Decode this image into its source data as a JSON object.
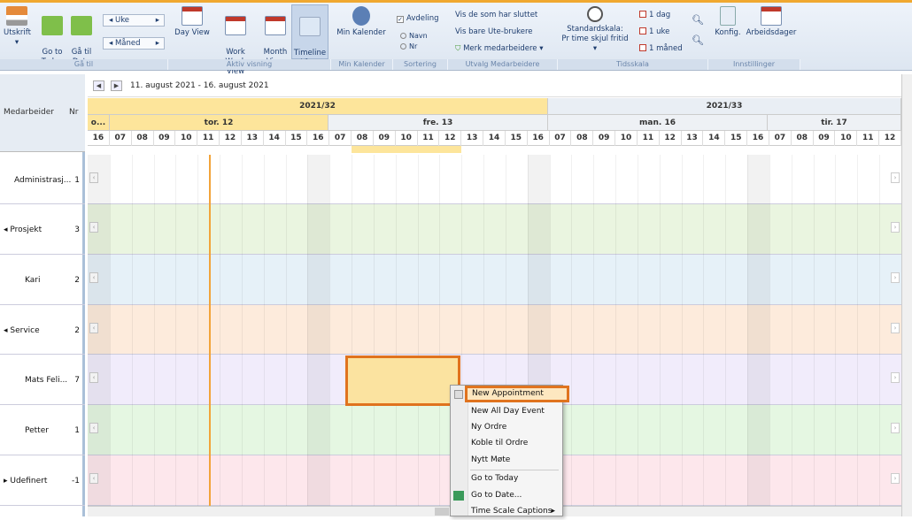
{
  "ribbon": {
    "buttons": {
      "print": "Utskrift",
      "go_today": "Go to\nToday",
      "go_date": "Gå til\nDato",
      "uke": "Uke",
      "maned": "Måned",
      "day_view": "Day View",
      "work_week": "Work\nWeek View",
      "month_view": "Month\nView",
      "timeline_view": "Timeline\nView",
      "min_kalender": "Min Kalender",
      "avdeling": "Avdeling",
      "navn": "Navn",
      "nr": "Nr",
      "vis_sluttet": "Vis de som har sluttet",
      "vis_ute": "Vis bare Ute-brukere",
      "merk": "Merk medarbeidere",
      "standardskala": "Standardskala:",
      "pr_time": "Pr time skjul fritid",
      "dag1": "1 dag",
      "uke1": "1 uke",
      "maned1": "1 måned",
      "konfig": "Konfig.",
      "arbeidsdager": "Arbeidsdager"
    },
    "groups": [
      "Gå til",
      "Aktiv visning",
      "Min Kalender",
      "Sortering",
      "Utvalg Medarbeidere",
      "Tidsskala",
      "Innstillinger"
    ]
  },
  "left": {
    "col_medarbeider": "Medarbeider",
    "col_nr": "Nr",
    "rows": [
      {
        "label": "Administrasj...",
        "nr": "1"
      },
      {
        "label": "Prosjekt",
        "nr": "3"
      },
      {
        "label": "Kari",
        "nr": "2"
      },
      {
        "label": "Service",
        "nr": "2"
      },
      {
        "label": "Mats Feli...",
        "nr": "7"
      },
      {
        "label": "Petter",
        "nr": "1"
      },
      {
        "label": "Udefinert",
        "nr": "-1"
      }
    ]
  },
  "nav": {
    "range": "11. august 2021 - 16. august 2021"
  },
  "weeks": [
    "2021/32",
    "2021/33"
  ],
  "days": [
    "o...",
    "tor. 12",
    "fre. 13",
    "man. 16",
    "tir. 17"
  ],
  "hours": [
    "16",
    "07",
    "08",
    "09",
    "10",
    "11",
    "12",
    "13",
    "14",
    "15",
    "16",
    "07",
    "08",
    "09",
    "10",
    "11",
    "12",
    "13",
    "14",
    "15",
    "16",
    "07",
    "08",
    "09",
    "10",
    "11",
    "12",
    "13",
    "14",
    "15",
    "16",
    "07",
    "08",
    "09",
    "10",
    "11",
    "12"
  ],
  "menu": {
    "items": [
      "New Appointment",
      "New All Day Event",
      "Ny Ordre",
      "Koble til Ordre",
      "Nytt Møte",
      "Go to Today",
      "Go to Date...",
      "Time Scale Captions"
    ]
  },
  "colors": {
    "accent": "#e0731e",
    "week_highlight": "#fde59b",
    "bands": [
      "#ffffff",
      "#eaf5e0",
      "#e6f1f8",
      "#fdebdc",
      "#f1ecfb",
      "#e5f7e2",
      "#fde7ec"
    ]
  }
}
